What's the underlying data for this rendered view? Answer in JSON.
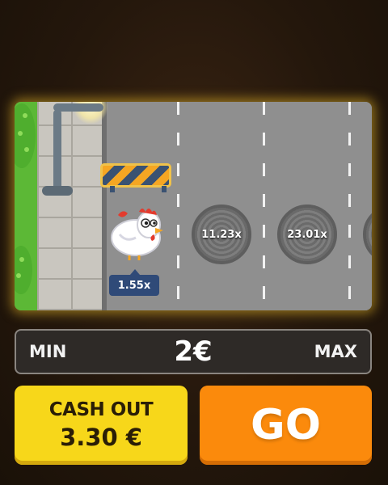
{
  "game": {
    "current_multiplier": "1.55x",
    "lane_multipliers": [
      "11.23x",
      "23.01x"
    ]
  },
  "bet": {
    "min_label": "MIN",
    "amount": "2€",
    "max_label": "MAX"
  },
  "cashout": {
    "label": "CASH OUT",
    "amount": "3.30 €"
  },
  "go_button": {
    "label": "GO"
  },
  "colors": {
    "cashout_bg": "#f7d71a",
    "go_bg": "#fb8a0c",
    "board_glow": "#e8b828",
    "tag_bg": "#2f4a78"
  },
  "icons": [
    "street-lamp-icon",
    "road-barrier-icon",
    "chicken-icon",
    "manhole-icon",
    "bush-icon"
  ]
}
